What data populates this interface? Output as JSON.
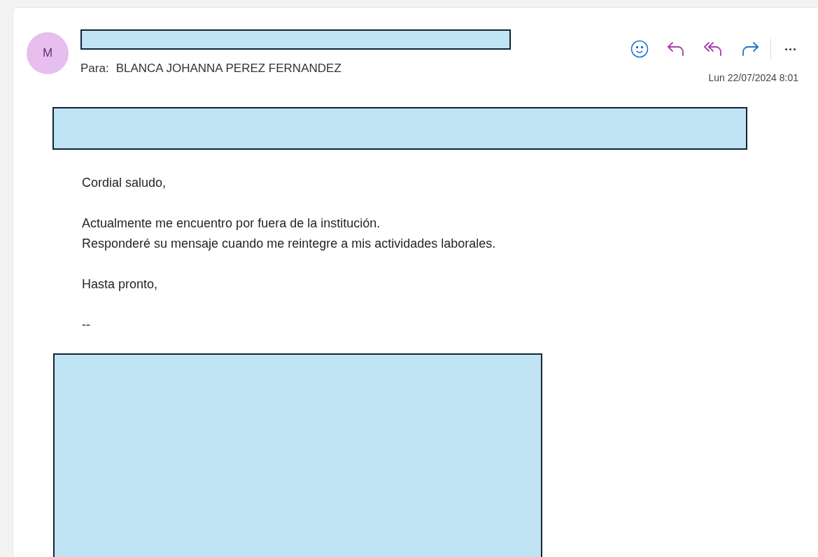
{
  "message": {
    "avatar_initial": "M",
    "to_label": "Para:",
    "recipient": "BLANCA JOHANNA PEREZ FERNANDEZ",
    "date": "Lun 22/07/2024 8:01",
    "body": [
      [
        "Cordial saludo,"
      ],
      [
        "Actualmente me encuentro por fuera de la institución.",
        "Responderé su mensaje cuando me reintegre a mis actividades laborales."
      ],
      [
        "Hasta pronto,"
      ],
      [
        "--"
      ]
    ]
  }
}
